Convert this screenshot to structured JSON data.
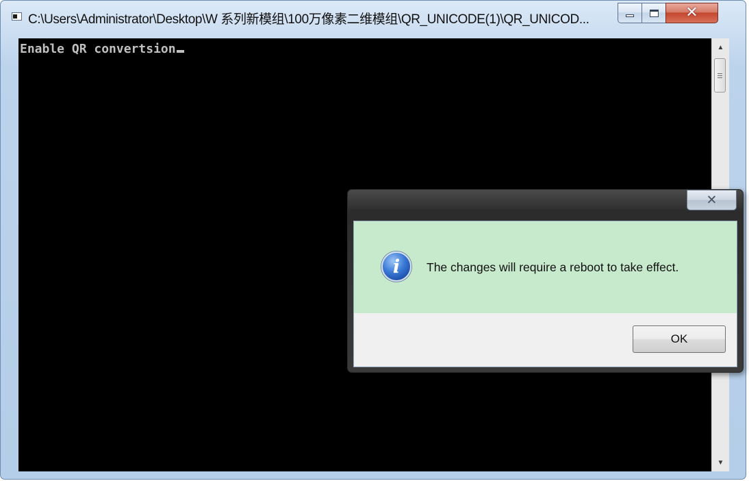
{
  "console_window": {
    "title": "C:\\Users\\Administrator\\Desktop\\W 系列新模组\\100万像素二维模组\\QR_UNICODE(1)\\QR_UNICOD...",
    "console_output": "Enable QR convertsion"
  },
  "message_box": {
    "message": "The changes will require a reboot to take effect.",
    "ok_label": "OK",
    "icon": "information-icon"
  }
}
